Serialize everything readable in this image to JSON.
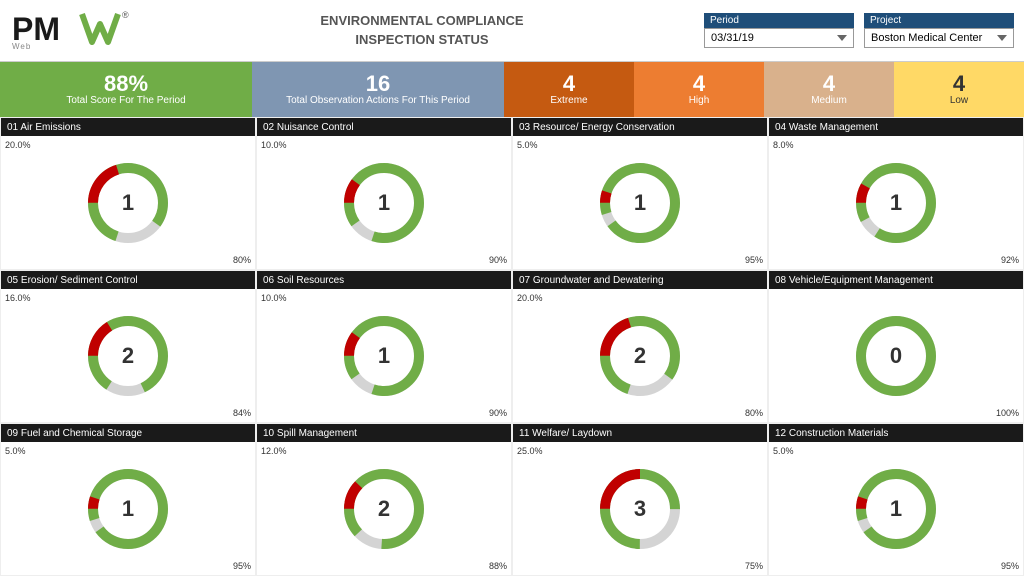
{
  "header": {
    "title_line1": "ENVIRONMENTAL COMPLIANCE",
    "title_line2": "INSPECTION STATUS",
    "period_label": "Period",
    "period_value": "03/31/19",
    "project_label": "Project",
    "project_value": "Boston Medical Center"
  },
  "summary": {
    "score_value": "88%",
    "score_label": "Total Score For The Period",
    "observations_value": "16",
    "observations_label": "Total Observation Actions For This Period",
    "extreme_value": "4",
    "extreme_label": "Extreme",
    "high_value": "4",
    "high_label": "High",
    "medium_value": "4",
    "medium_label": "Medium",
    "low_value": "4",
    "low_label": "Low"
  },
  "charts": [
    {
      "row": 0,
      "cells": [
        {
          "id": "01",
          "title": "01 Air Emissions",
          "number": "1",
          "pct_green": 80,
          "pct_red": 20,
          "label_tl": "20.0%",
          "label_br": "80%"
        },
        {
          "id": "02",
          "title": "02 Nuisance Control",
          "number": "1",
          "pct_green": 90,
          "pct_red": 10,
          "label_tl": "10.0%",
          "label_br": "90%"
        },
        {
          "id": "03",
          "title": "03 Resource/ Energy Conservation",
          "number": "1",
          "pct_green": 95,
          "pct_red": 5,
          "label_tl": "5.0%",
          "label_br": "95%"
        },
        {
          "id": "04",
          "title": "04 Waste Management",
          "number": "1",
          "pct_green": 92,
          "pct_red": 8,
          "label_tl": "8.0%",
          "label_br": "92%"
        }
      ]
    },
    {
      "row": 1,
      "cells": [
        {
          "id": "05",
          "title": "05 Erosion/ Sediment Control",
          "number": "2",
          "pct_green": 84,
          "pct_red": 16,
          "label_tl": "16.0%",
          "label_br": "84%"
        },
        {
          "id": "06",
          "title": "06 Soil Resources",
          "number": "1",
          "pct_green": 90,
          "pct_red": 10,
          "label_tl": "10.0%",
          "label_br": "90%"
        },
        {
          "id": "07",
          "title": "07 Groundwater and Dewatering",
          "number": "2",
          "pct_green": 80,
          "pct_red": 20,
          "label_tl": "20.0%",
          "label_br": "80%"
        },
        {
          "id": "08",
          "title": "08 Vehicle/Equipment Management",
          "number": "0",
          "pct_green": 100,
          "pct_red": 0,
          "label_tl": "",
          "label_br": "100%"
        }
      ]
    },
    {
      "row": 2,
      "cells": [
        {
          "id": "09",
          "title": "09 Fuel and Chemical Storage",
          "number": "1",
          "pct_green": 95,
          "pct_red": 5,
          "label_tl": "5.0%",
          "label_br": "95%"
        },
        {
          "id": "10",
          "title": "10 Spill Management",
          "number": "2",
          "pct_green": 88,
          "pct_red": 12,
          "label_tl": "12.0%",
          "label_br": "88%"
        },
        {
          "id": "11",
          "title": "11 Welfare/ Laydown",
          "number": "3",
          "pct_green": 75,
          "pct_red": 25,
          "label_tl": "25.0%",
          "label_br": "75%"
        },
        {
          "id": "12",
          "title": "12 Construction Materials",
          "number": "1",
          "pct_green": 95,
          "pct_red": 5,
          "label_tl": "5.0%",
          "label_br": "95%"
        }
      ]
    }
  ],
  "colors": {
    "green": "#70ad47",
    "red": "#c00000",
    "ring_bg": "#e0e0e0"
  }
}
